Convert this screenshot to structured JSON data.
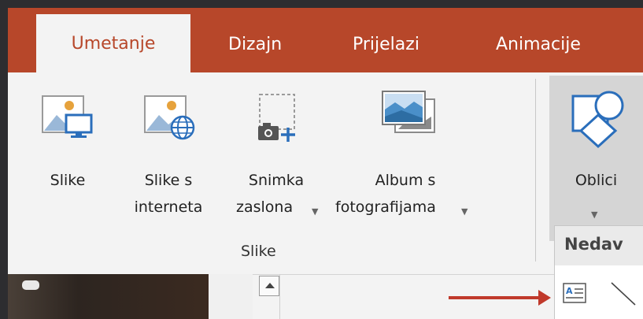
{
  "tabs": [
    {
      "label": "Umetanje",
      "active": true
    },
    {
      "label": "Dizajn",
      "active": false
    },
    {
      "label": "Prijelazi",
      "active": false
    },
    {
      "label": "Animacije",
      "active": false
    }
  ],
  "ribbon": {
    "buttons": [
      {
        "line1": "Slike",
        "line2": "",
        "icon": "pictures-icon"
      },
      {
        "line1": "Slike s",
        "line2": "interneta",
        "icon": "online-pictures-icon"
      },
      {
        "line1": "Snimka",
        "line2": "zaslona",
        "has_dropdown": true,
        "icon": "screenshot-icon"
      },
      {
        "line1": "Album s",
        "line2": "fotografijama",
        "has_dropdown": true,
        "icon": "photo-album-icon"
      }
    ],
    "group_label": "Slike",
    "shapes_button": {
      "label": "Oblici",
      "icon": "shapes-icon"
    }
  },
  "dropdown_panel": {
    "heading": "Nedav",
    "items": [
      "text-box-icon",
      "line-icon"
    ]
  },
  "colors": {
    "accent": "#b7472a",
    "ribbon_bg": "#f3f3f3",
    "annotation_arrow": "#c0392b"
  }
}
